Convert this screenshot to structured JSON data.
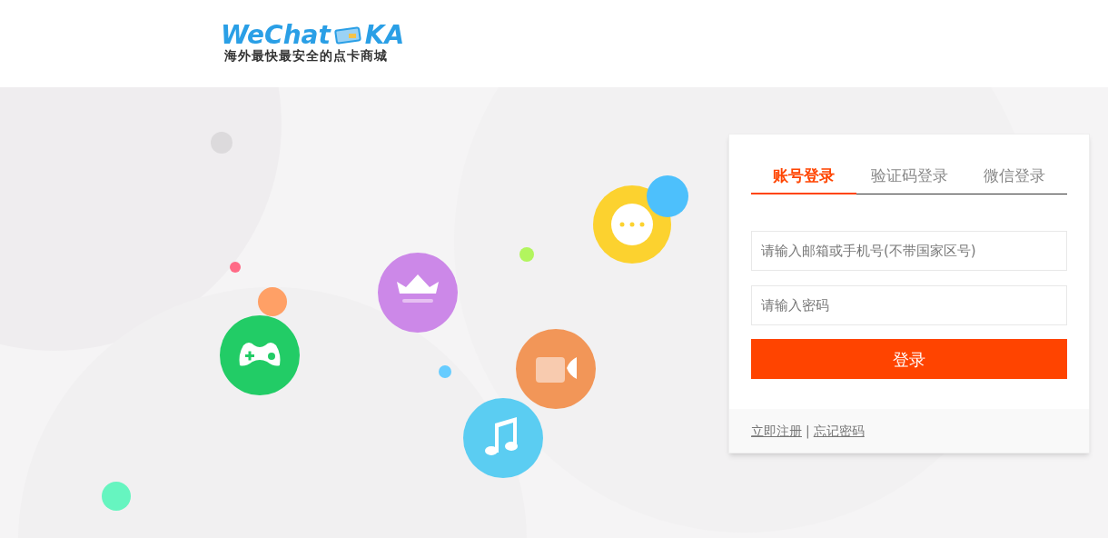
{
  "logo": {
    "brand_left": "WeChat",
    "brand_right": "KA",
    "tagline": "海外最快最安全的点卡商城"
  },
  "login": {
    "tabs": [
      {
        "label": "账号登录",
        "selected": true
      },
      {
        "label": "验证码登录",
        "selected": false
      },
      {
        "label": "微信登录",
        "selected": false
      }
    ],
    "fields": [
      {
        "placeholder": "请输入邮箱或手机号(不带国家区号)"
      },
      {
        "placeholder": "请输入密码"
      }
    ],
    "submit": "登录",
    "links": [
      {
        "label": "立即注册"
      },
      {
        "label": "忘记密码"
      }
    ],
    "separator": "|"
  }
}
